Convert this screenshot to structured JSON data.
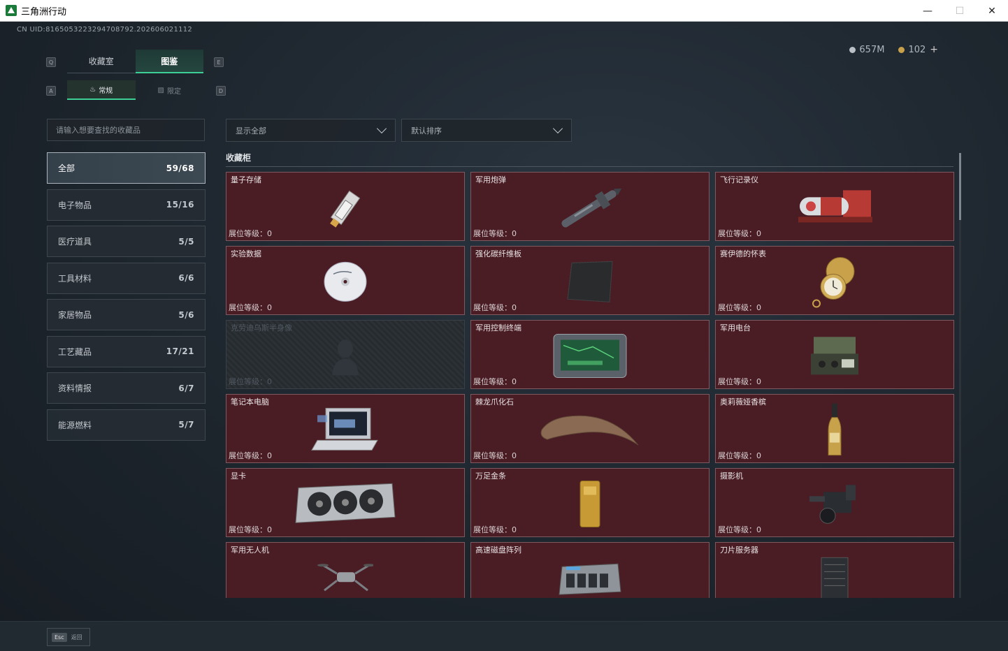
{
  "window": {
    "title": "三角洲行动",
    "minimize": "—",
    "maximize": "☐",
    "close": "✕"
  },
  "header": {
    "uid": "CN UID:8165053223294708792.202606021112",
    "currency": [
      {
        "icon": "silver-coin-icon",
        "value": "657M"
      },
      {
        "icon": "gold-coin-icon",
        "value": "102"
      }
    ],
    "plus": "+"
  },
  "tabs": {
    "keys": {
      "left": "Q",
      "right": "E",
      "sub_left": "A",
      "sub_right": "D"
    },
    "main": [
      {
        "label": "收藏室",
        "active": false
      },
      {
        "label": "图鉴",
        "active": true
      }
    ],
    "sub": [
      {
        "label": "常规",
        "icon": "flame-icon",
        "active": true
      },
      {
        "label": "限定",
        "icon": "image-icon",
        "active": false
      }
    ]
  },
  "search": {
    "placeholder": "请输入想要查找的收藏品",
    "value": ""
  },
  "filters": {
    "show": "显示全部",
    "sort": "默认排序"
  },
  "categories": [
    {
      "label": "全部",
      "count": "59/68",
      "active": true
    },
    {
      "label": "电子物品",
      "count": "15/16",
      "active": false
    },
    {
      "label": "医疗道具",
      "count": "5/5",
      "active": false
    },
    {
      "label": "工具材料",
      "count": "6/6",
      "active": false
    },
    {
      "label": "家居物品",
      "count": "5/6",
      "active": false
    },
    {
      "label": "工艺藏品",
      "count": "17/21",
      "active": false
    },
    {
      "label": "资料情报",
      "count": "6/7",
      "active": false
    },
    {
      "label": "能源燃料",
      "count": "5/7",
      "active": false
    }
  ],
  "collection": {
    "title": "收藏柜",
    "level_label": "展位等级：0",
    "items": [
      {
        "name": "量子存储",
        "icon": "quantum-storage-icon",
        "locked": false
      },
      {
        "name": "军用炮弹",
        "icon": "military-shell-icon",
        "locked": false
      },
      {
        "name": "飞行记录仪",
        "icon": "flight-recorder-icon",
        "locked": false
      },
      {
        "name": "实验数据",
        "icon": "cd-disc-icon",
        "locked": false
      },
      {
        "name": "强化碳纤维板",
        "icon": "carbon-plate-icon",
        "locked": false
      },
      {
        "name": "赛伊德的怀表",
        "icon": "pocket-watch-icon",
        "locked": false
      },
      {
        "name": "克劳迪乌斯半身像",
        "icon": "bust-icon",
        "locked": true
      },
      {
        "name": "军用控制终端",
        "icon": "control-terminal-icon",
        "locked": false
      },
      {
        "name": "军用电台",
        "icon": "military-radio-icon",
        "locked": false
      },
      {
        "name": "笔记本电脑",
        "icon": "laptop-icon",
        "locked": false
      },
      {
        "name": "棘龙爪化石",
        "icon": "claw-fossil-icon",
        "locked": false
      },
      {
        "name": "奥莉薇娅香槟",
        "icon": "champagne-icon",
        "locked": false
      },
      {
        "name": "显卡",
        "icon": "graphics-card-icon",
        "locked": false
      },
      {
        "name": "万足金条",
        "icon": "gold-bar-icon",
        "locked": false
      },
      {
        "name": "摄影机",
        "icon": "camera-icon",
        "locked": false
      },
      {
        "name": "军用无人机",
        "icon": "drone-icon",
        "locked": false
      },
      {
        "name": "高速磁盘阵列",
        "icon": "disk-array-icon",
        "locked": false
      },
      {
        "name": "刀片服务器",
        "icon": "blade-server-icon",
        "locked": false
      }
    ]
  },
  "footer": {
    "esc_key": "Esc",
    "esc_label": "返回"
  }
}
